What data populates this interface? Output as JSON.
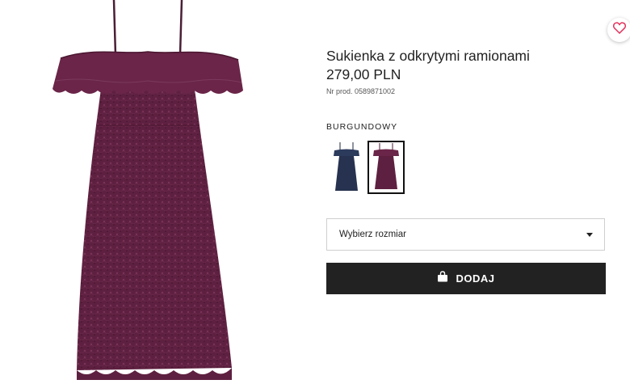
{
  "product": {
    "title": "Sukienka z odkrytymi ramionami",
    "price": "279,00 PLN",
    "article_number": "Nr prod. 0589871002",
    "image_icon": "burgundy-lace-dress-image"
  },
  "favorite": {
    "icon": "heart-icon",
    "color": "#e2315b"
  },
  "colors": {
    "selected_label": "BURGUNDOWY",
    "options": [
      {
        "name": "navy",
        "hex": "#26324f",
        "selected": false
      },
      {
        "name": "burgundy",
        "hex": "#5e2040",
        "selected": true
      }
    ]
  },
  "size_select": {
    "placeholder": "Wybierz rozmiar",
    "icon": "chevron-down-icon"
  },
  "add_to_cart": {
    "label": "DODAJ",
    "icon": "shopping-bag-icon",
    "background": "#222222"
  }
}
